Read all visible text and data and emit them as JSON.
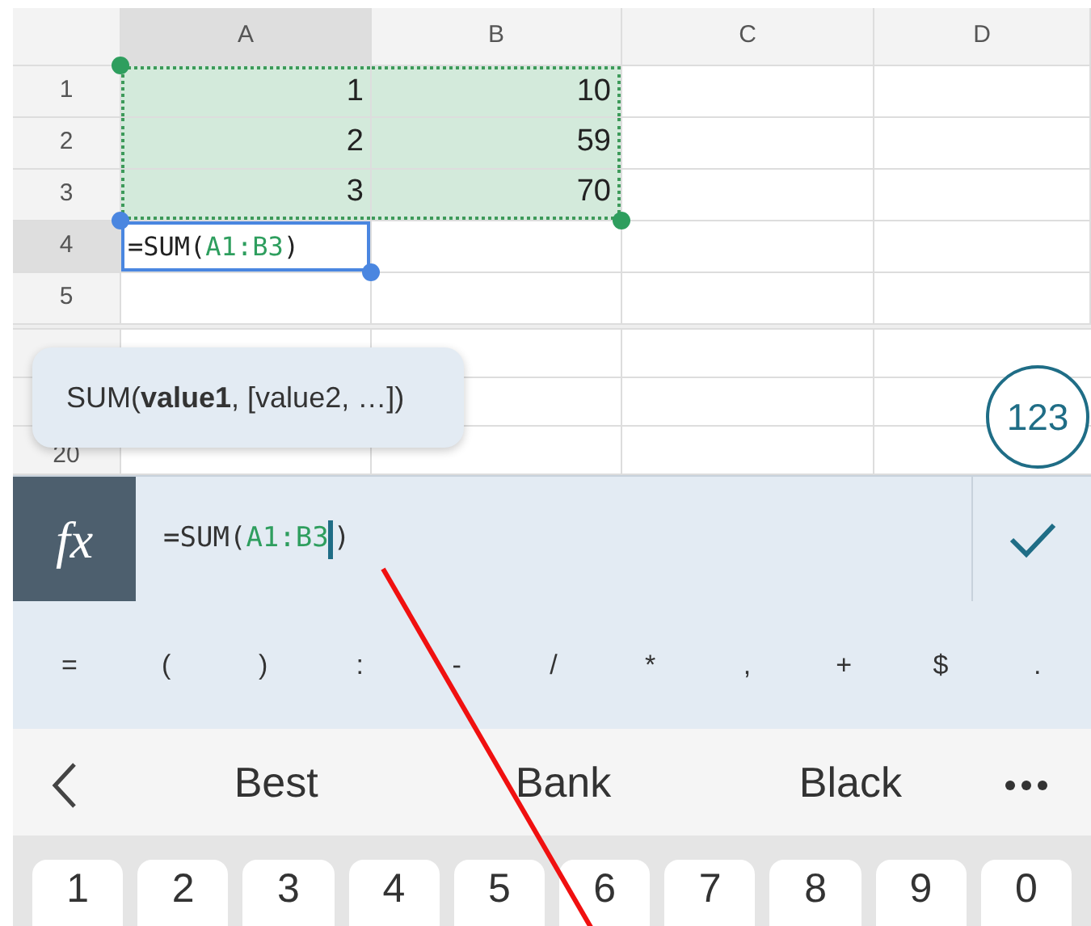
{
  "sheet": {
    "columns": [
      {
        "label": "A",
        "active": true
      },
      {
        "label": "B",
        "active": false
      },
      {
        "label": "C",
        "active": false
      },
      {
        "label": "D",
        "active": false
      }
    ],
    "rows": [
      {
        "label": "1",
        "active": false,
        "cells": [
          {
            "text": "1",
            "in_range": true
          },
          {
            "text": "10",
            "in_range": true
          },
          null,
          null
        ]
      },
      {
        "label": "2",
        "active": false,
        "cells": [
          {
            "text": "2",
            "in_range": true
          },
          {
            "text": "59",
            "in_range": true
          },
          null,
          null
        ]
      },
      {
        "label": "3",
        "active": false,
        "cells": [
          {
            "text": "3",
            "in_range": true
          },
          {
            "text": "70",
            "in_range": true
          },
          null,
          null
        ]
      },
      {
        "label": "4",
        "active": true,
        "cells": [
          {
            "segments": [
              {
                "kind": "plain",
                "text": "=SUM("
              },
              {
                "kind": "ref",
                "text": "A1:B3"
              },
              {
                "kind": "plain",
                "text": ")"
              }
            ],
            "active": true,
            "in_range": false
          },
          null,
          null,
          null
        ]
      },
      {
        "label": "5",
        "active": false,
        "cells": [
          null,
          null,
          null,
          null
        ]
      }
    ],
    "lower_rows": [
      {
        "label": null
      },
      {
        "label": null
      },
      {
        "label": "20"
      }
    ]
  },
  "tooltip": "SUM(**value1**, [value2, …])",
  "mode_button": "123",
  "formula_bar": {
    "function_button": "fx",
    "segments": [
      {
        "kind": "plain",
        "text": "=SUM("
      },
      {
        "kind": "ref",
        "text": "A1:B3"
      },
      {
        "kind": "cursor"
      },
      {
        "kind": "plain",
        "text": ")"
      }
    ]
  },
  "symbol_keys": [
    "=",
    "(",
    ")",
    ":",
    "-",
    "/",
    "*",
    ",",
    "+",
    "$",
    "."
  ],
  "suggestions": [
    "Best",
    "Bank",
    "Black"
  ],
  "number_keys": [
    "1",
    "2",
    "3",
    "4",
    "5",
    "6",
    "7",
    "8",
    "9",
    "0"
  ]
}
